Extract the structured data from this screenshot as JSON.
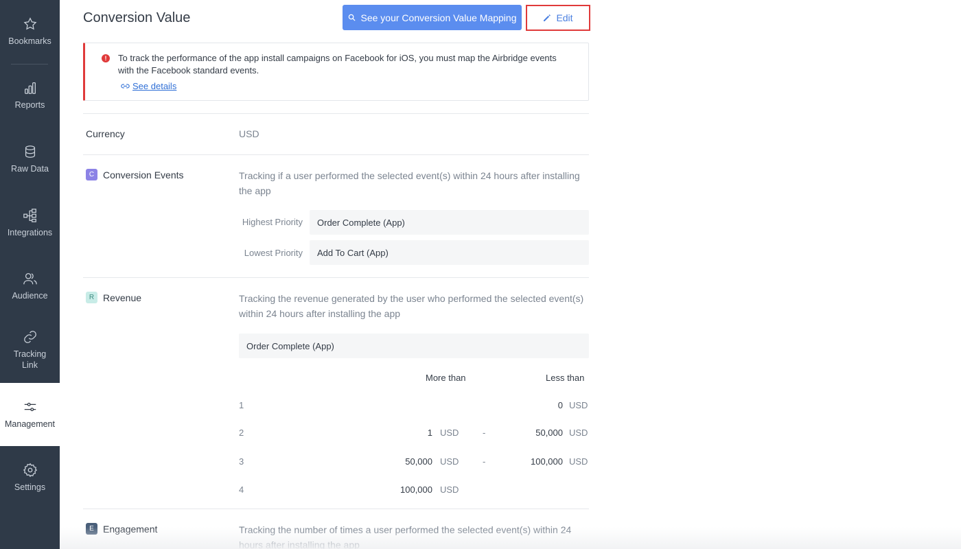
{
  "sidebar": {
    "items": [
      {
        "label": "Bookmarks",
        "icon": "star-icon"
      },
      {
        "label": "Reports",
        "icon": "bar-chart-icon"
      },
      {
        "label": "Raw Data",
        "icon": "database-icon"
      },
      {
        "label": "Integrations",
        "icon": "integrations-icon"
      },
      {
        "label": "Audience",
        "icon": "users-icon"
      },
      {
        "label": "Tracking\nLink",
        "icon": "link-icon"
      },
      {
        "label": "Management",
        "icon": "sliders-icon",
        "active": true
      },
      {
        "label": "Settings",
        "icon": "gear-icon"
      }
    ]
  },
  "header": {
    "title": "Conversion Value",
    "mapping_button": "See your Conversion Value Mapping",
    "edit_button": "Edit"
  },
  "alert": {
    "text": "To track the performance of the app install campaigns on Facebook for iOS, you must map the Airbridge events with the Facebook standard events.",
    "link": "See details"
  },
  "currency": {
    "label": "Currency",
    "value": "USD"
  },
  "conversion_events": {
    "badge": "C",
    "label": "Conversion Events",
    "description": "Tracking if a user performed the selected event(s) within 24 hours after installing the app",
    "highest_label": "Highest Priority",
    "highest_value": "Order Complete (App)",
    "lowest_label": "Lowest Priority",
    "lowest_value": "Add To Cart (App)"
  },
  "revenue": {
    "badge": "R",
    "label": "Revenue",
    "description": "Tracking the revenue generated by the user who performed the selected event(s) within 24 hours after installing the app",
    "event": "Order Complete (App)",
    "col_more": "More than",
    "col_less": "Less than",
    "rows": [
      {
        "idx": "1",
        "more": "",
        "more_unit": "",
        "dash": "",
        "less": "0",
        "less_unit": "USD"
      },
      {
        "idx": "2",
        "more": "1",
        "more_unit": "USD",
        "dash": "-",
        "less": "50,000",
        "less_unit": "USD"
      },
      {
        "idx": "3",
        "more": "50,000",
        "more_unit": "USD",
        "dash": "-",
        "less": "100,000",
        "less_unit": "USD"
      },
      {
        "idx": "4",
        "more": "100,000",
        "more_unit": "USD",
        "dash": "",
        "less": "",
        "less_unit": ""
      }
    ]
  },
  "engagement": {
    "badge": "E",
    "label": "Engagement",
    "description": "Tracking the number of times a user performed the selected event(s) within 24 hours after installing the app"
  },
  "colors": {
    "sidebar_bg": "#2f3a48",
    "primary": "#5b8def",
    "alert_red": "#e03a3a"
  }
}
